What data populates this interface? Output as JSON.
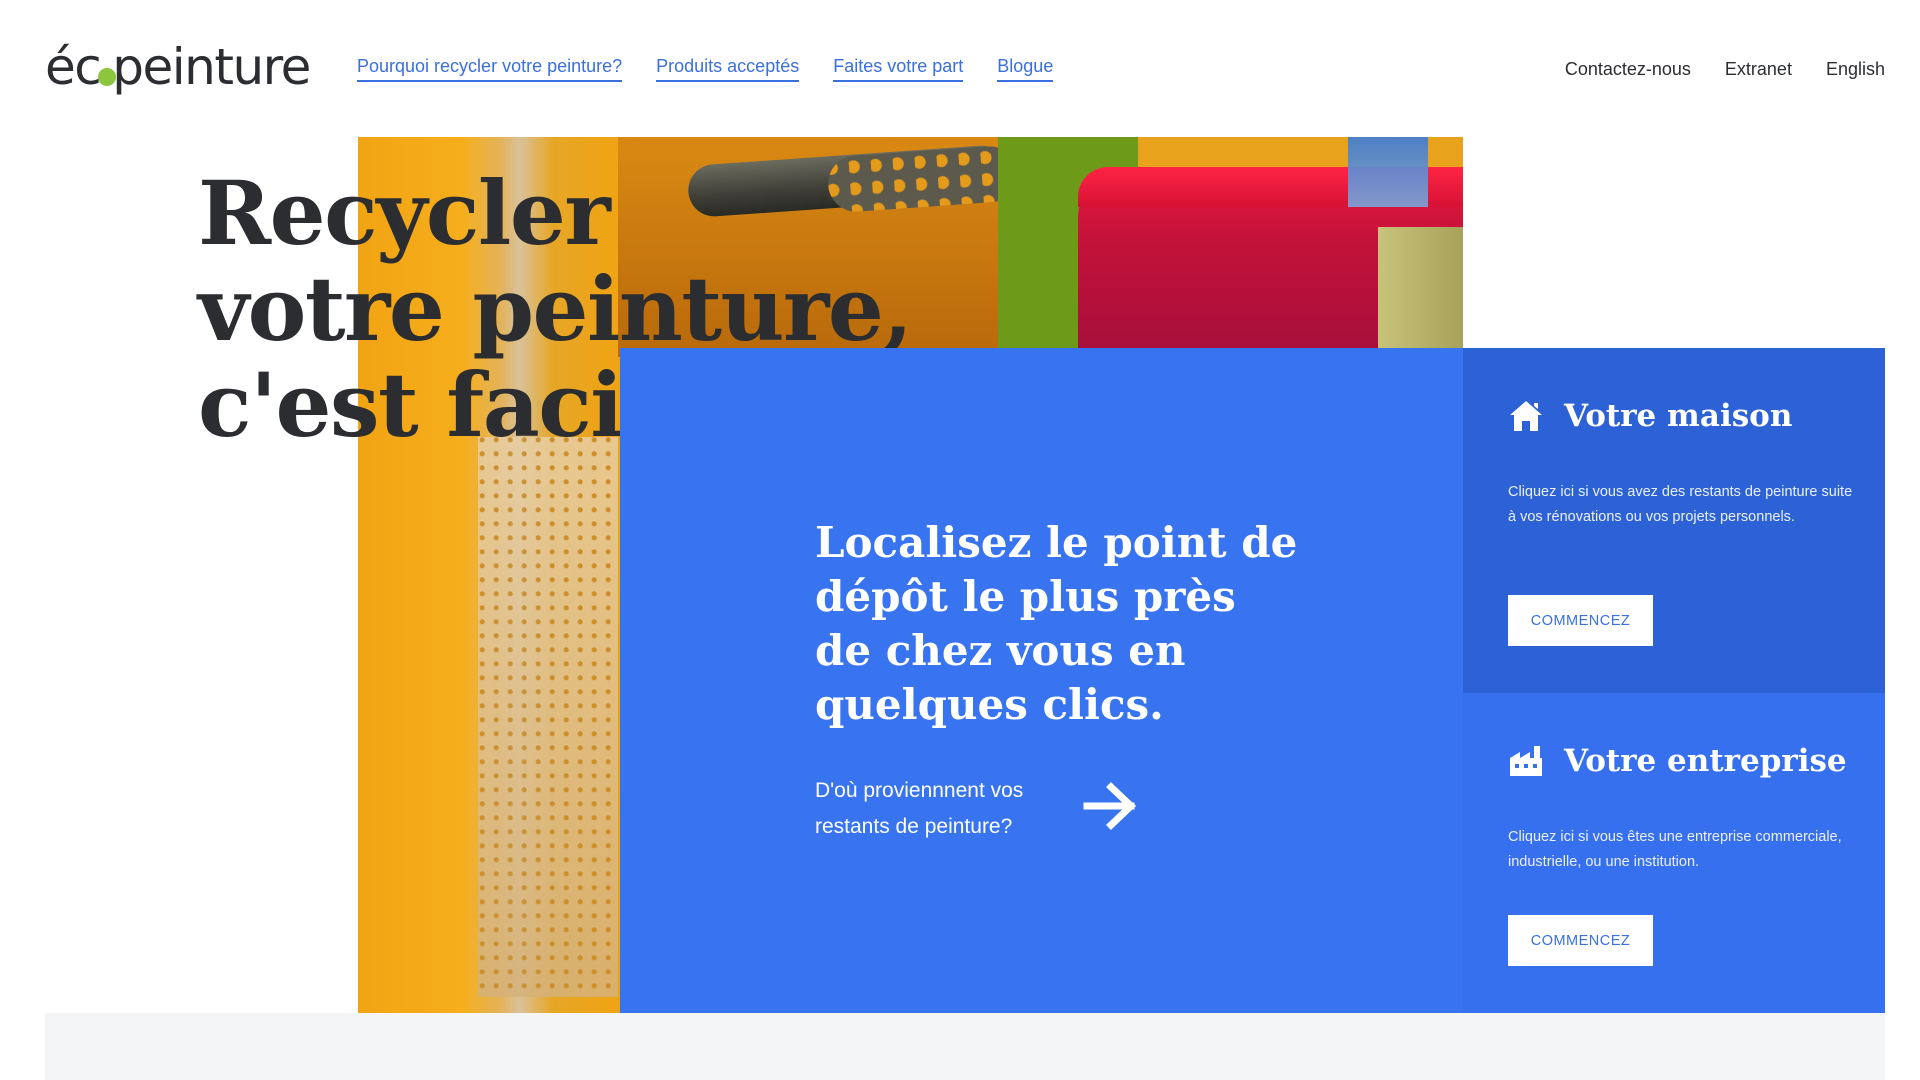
{
  "header": {
    "logo": {
      "pre": "éc",
      "post": "peinture"
    },
    "nav_left": [
      {
        "label": "Pourquoi recycler votre peinture?"
      },
      {
        "label": "Produits acceptés"
      },
      {
        "label": "Faites votre part"
      },
      {
        "label": "Blogue"
      }
    ],
    "nav_right": [
      {
        "label": "Contactez-nous"
      },
      {
        "label": "Extranet"
      },
      {
        "label": "English"
      }
    ]
  },
  "hero": {
    "headline_lines": [
      "Recycler",
      "votre peinture,",
      "c'est facile."
    ]
  },
  "locate": {
    "title_lines": [
      "Localisez le point de",
      "dépôt le plus près",
      "de chez vous en",
      "quelques clics."
    ],
    "subtitle": "D'où proviennnent vos restants de peinture?",
    "arrow_icon": "arrow-right-icon"
  },
  "cards": [
    {
      "icon": "house-icon",
      "title": "Votre maison",
      "text": "Cliquez ici si vous avez des restants de peinture suite à vos rénovations ou vos projets personnels.",
      "button": "COMMENCEZ"
    },
    {
      "icon": "factory-icon",
      "title": "Votre entreprise",
      "text": "Cliquez ici si vous êtes une entreprise commerciale, industrielle, ou une institution.",
      "button": "COMMENCEZ"
    }
  ],
  "colors": {
    "accent_blue": "#3874f0",
    "card_blue_dark": "#2d62d6",
    "link_blue": "#3a6fde",
    "logo_green": "#8cc63f",
    "text_dark": "#2b2d31"
  }
}
